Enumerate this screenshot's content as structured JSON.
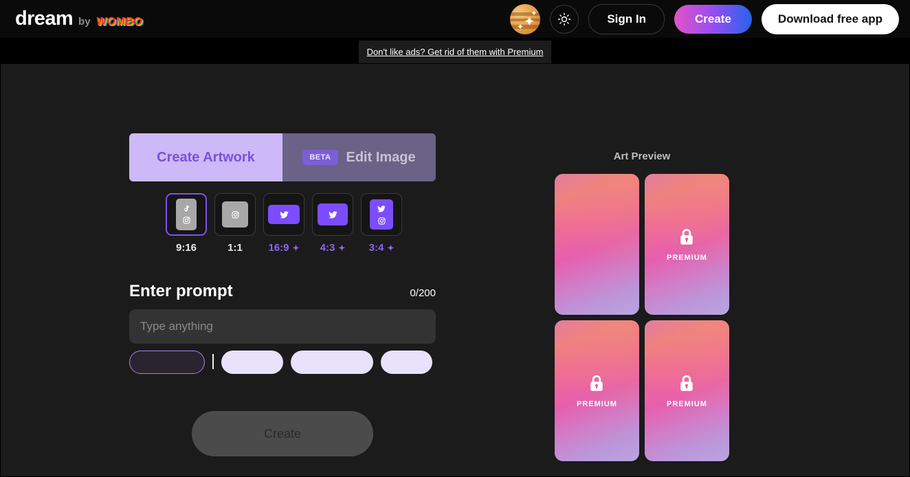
{
  "header": {
    "brand": {
      "name": "dream",
      "by": "by",
      "partner": "WOMBO"
    },
    "avatar_icon": "sparkle-planet-avatar",
    "theme_toggle_icon": "sun-icon",
    "sign_in_label": "Sign In",
    "create_label": "Create",
    "download_label": "Download free app"
  },
  "ad_banner": {
    "text": "Don't like ads? Get rid of them with Premium"
  },
  "creator": {
    "tabs": [
      {
        "label": "Create Artwork",
        "active": true,
        "badge": null
      },
      {
        "label": "Edit Image",
        "active": false,
        "badge": "BETA"
      }
    ],
    "ratios": [
      {
        "label": "9:16",
        "selected": true,
        "premium": false,
        "icons": [
          "tiktok-icon",
          "instagram-icon"
        ],
        "swatch": "gray"
      },
      {
        "label": "1:1",
        "selected": false,
        "premium": false,
        "icons": [
          "instagram-icon"
        ],
        "swatch": "gray"
      },
      {
        "label": "16:9",
        "selected": false,
        "premium": true,
        "icons": [
          "twitter-icon"
        ],
        "swatch": "purple"
      },
      {
        "label": "4:3",
        "selected": false,
        "premium": true,
        "icons": [
          "twitter-icon"
        ],
        "swatch": "purple"
      },
      {
        "label": "3:4",
        "selected": false,
        "premium": true,
        "icons": [
          "twitter-icon",
          "instagram-icon"
        ],
        "swatch": "purple"
      }
    ],
    "prompt": {
      "title": "Enter prompt",
      "counter": "0/200",
      "value": "",
      "placeholder": "Type anything"
    },
    "create_button_label": "Create",
    "create_button_enabled": false
  },
  "preview": {
    "title": "Art Preview",
    "cards": [
      {
        "locked": false,
        "label": ""
      },
      {
        "locked": true,
        "label": "PREMIUM"
      },
      {
        "locked": true,
        "label": "PREMIUM"
      },
      {
        "locked": true,
        "label": "PREMIUM"
      }
    ]
  },
  "colors": {
    "accent_purple": "#7c4dff",
    "tab_active_bg": "#cdb9f7",
    "tab_active_text": "#7b52d6",
    "page_bg": "#1b1b1b",
    "header_bg": "#0a0a0a",
    "gradient_start": "#ef8080",
    "gradient_end": "#b9a5e0"
  }
}
